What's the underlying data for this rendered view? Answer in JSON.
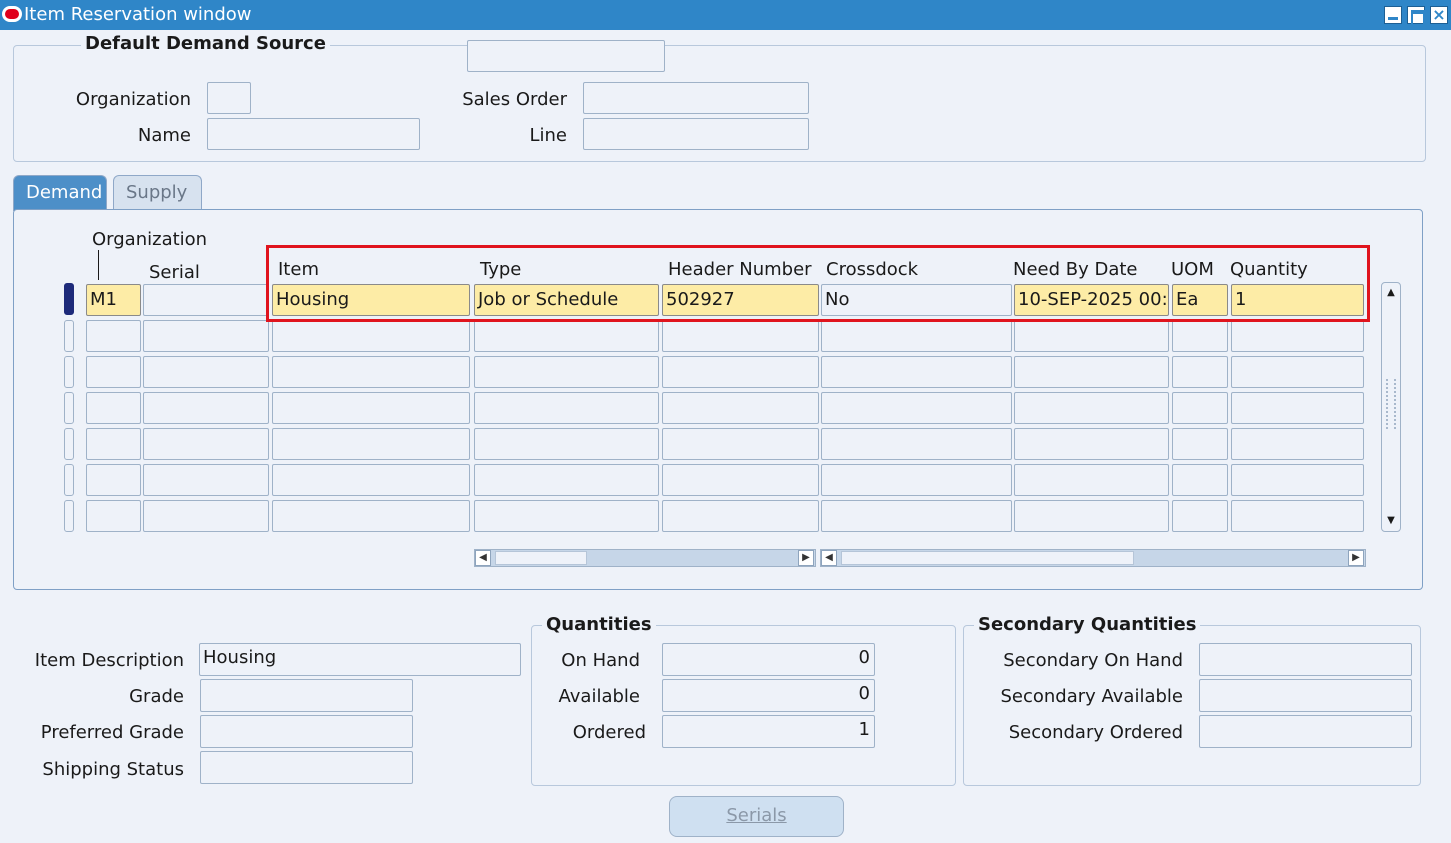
{
  "window": {
    "title": "Item Reservation window",
    "controls": [
      "minimize-icon",
      "maximize-icon",
      "close-icon"
    ]
  },
  "demand_source": {
    "title": "Default Demand Source",
    "organization_label": "Organization",
    "organization_value": "",
    "name_label": "Name",
    "name_value": "",
    "sales_order_label": "Sales Order",
    "sales_order_value": "",
    "line_label": "Line",
    "line_value": "",
    "top_field_value": ""
  },
  "tabs": [
    {
      "label": "Demand",
      "active": true
    },
    {
      "label": "Supply",
      "active": false
    }
  ],
  "grid": {
    "columns": {
      "organization": "Organization",
      "serial": "Serial",
      "item": "Item",
      "type": "Type",
      "header_number": "Header Number",
      "crossdock": "Crossdock",
      "need_by_date": "Need By Date",
      "uom": "UOM",
      "quantity": "Quantity"
    },
    "rows": [
      {
        "organization": "M1",
        "serial": "",
        "item": "Housing",
        "type": "Job or Schedule",
        "header_number": "502927",
        "crossdock": "No",
        "need_by_date": "10-SEP-2025 00:(",
        "uom": "Ea",
        "quantity": "1"
      }
    ],
    "empty_rows": 6
  },
  "item_details": {
    "item_description_label": "Item Description",
    "item_description_value": "Housing",
    "grade_label": "Grade",
    "grade_value": "",
    "preferred_grade_label": "Preferred Grade",
    "preferred_grade_value": "",
    "shipping_status_label": "Shipping Status",
    "shipping_status_value": ""
  },
  "quantities": {
    "title": "Quantities",
    "on_hand_label": "On Hand",
    "on_hand_value": "0",
    "available_label": "Available",
    "available_value": "0",
    "ordered_label": "Ordered",
    "ordered_value": "1"
  },
  "secondary_quantities": {
    "title": "Secondary Quantities",
    "on_hand_label": "Secondary On Hand",
    "on_hand_value": "",
    "available_label": "Secondary Available",
    "available_value": "",
    "ordered_label": "Secondary Ordered",
    "ordered_value": ""
  },
  "buttons": {
    "serials": "Serials"
  },
  "colors": {
    "titlebar": "#2f86c8",
    "highlight_box": "#e0141e",
    "current_record": "#fdeca6"
  }
}
